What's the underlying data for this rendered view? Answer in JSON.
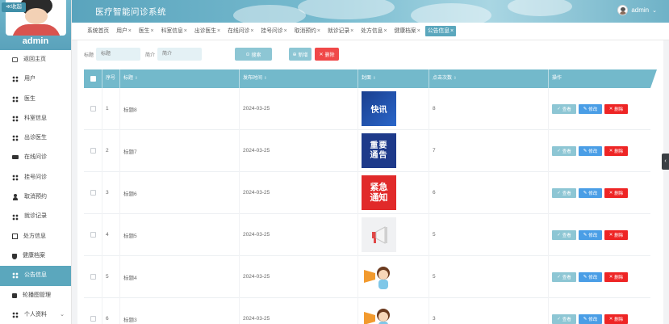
{
  "app": {
    "title": "医疗智能问诊系统",
    "user": "admin"
  },
  "sidebar": {
    "collapse_label": "≪收起",
    "username": "admin",
    "items": [
      {
        "label": "返回主页",
        "icon": "home-icon"
      },
      {
        "label": "用户",
        "icon": "grid-icon"
      },
      {
        "label": "医生",
        "icon": "grid-icon"
      },
      {
        "label": "科室信息",
        "icon": "grid-icon"
      },
      {
        "label": "出诊医生",
        "icon": "grid-icon"
      },
      {
        "label": "在线问诊",
        "icon": "monitor-icon"
      },
      {
        "label": "挂号问诊",
        "icon": "grid-icon"
      },
      {
        "label": "取消预约",
        "icon": "person-icon"
      },
      {
        "label": "就诊记录",
        "icon": "grid-icon"
      },
      {
        "label": "处方信息",
        "icon": "check-icon"
      },
      {
        "label": "健康档案",
        "icon": "shield-icon"
      },
      {
        "label": "公告信息",
        "icon": "grid-icon",
        "active": true
      },
      {
        "label": "轮播图管理",
        "icon": "square-icon"
      },
      {
        "label": "个人资料",
        "icon": "grid-icon"
      }
    ]
  },
  "tabs": [
    {
      "label": "系统首页",
      "closable": false
    },
    {
      "label": "用户",
      "closable": true
    },
    {
      "label": "医生",
      "closable": true
    },
    {
      "label": "科室信息",
      "closable": true
    },
    {
      "label": "出诊医生",
      "closable": true
    },
    {
      "label": "在线问诊",
      "closable": true
    },
    {
      "label": "挂号问诊",
      "closable": true
    },
    {
      "label": "取消预约",
      "closable": true
    },
    {
      "label": "就诊记录",
      "closable": true
    },
    {
      "label": "处方信息",
      "closable": true
    },
    {
      "label": "健康档案",
      "closable": true
    },
    {
      "label": "公告信息",
      "closable": true,
      "active": true
    }
  ],
  "filter": {
    "title_label": "标题",
    "title_placeholder": "标题",
    "intro_label": "简介",
    "intro_placeholder": "简介",
    "search_label": "搜索",
    "add_label": "新增",
    "delete_label": "删除"
  },
  "table": {
    "headers": [
      "序号",
      "标题",
      "发布时间",
      "封面",
      "点击次数",
      "操作"
    ],
    "rows": [
      {
        "index": "1",
        "title": "标题8",
        "date": "2024-03-25",
        "cover": "快讯",
        "cover_type": "kx",
        "clicks": "8"
      },
      {
        "index": "2",
        "title": "标题7",
        "date": "2024-03-25",
        "cover": "重要通告",
        "cover_type": "zy",
        "clicks": "7"
      },
      {
        "index": "3",
        "title": "标题6",
        "date": "2024-03-25",
        "cover": "紧急通知",
        "cover_type": "jj",
        "clicks": "6"
      },
      {
        "index": "4",
        "title": "标题5",
        "date": "2024-03-25",
        "cover": "",
        "cover_type": "lb",
        "clicks": "5"
      },
      {
        "index": "5",
        "title": "标题4",
        "date": "2024-03-25",
        "cover": "",
        "cover_type": "mg",
        "clicks": "5"
      },
      {
        "index": "6",
        "title": "标题3",
        "date": "2024-03-25",
        "cover": "",
        "cover_type": "mg",
        "clicks": "3"
      }
    ],
    "actions": {
      "view": "查看",
      "edit": "修改",
      "delete": "删除"
    }
  },
  "colors": {
    "accent": "#5ba7bd",
    "header_row": "#73b9cb",
    "danger": "#f04848",
    "edit": "#4a9ee6"
  }
}
